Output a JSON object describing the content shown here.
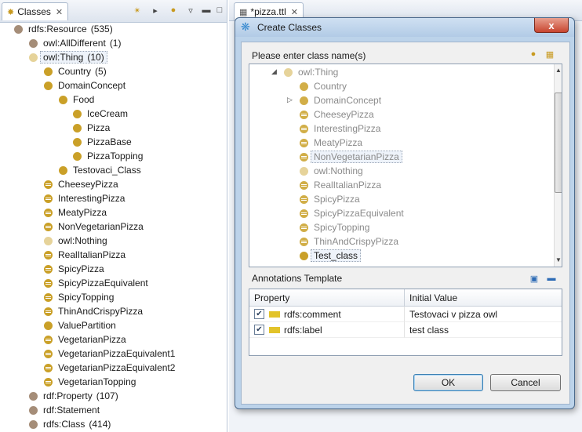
{
  "left_view": {
    "tab_label": "Classes",
    "toolbar_icons": [
      "add-subclass-icon",
      "add-sibling-icon",
      "delete-class-icon",
      "view-menu-icon",
      "minimize-icon",
      "maximize-icon"
    ],
    "tree": [
      {
        "label": "rdfs:Resource",
        "count": "(535)",
        "icon": "resource",
        "depth": 0
      },
      {
        "label": "owl:AllDifferent",
        "count": "(1)",
        "icon": "resource",
        "depth": 1
      },
      {
        "label": "owl:Thing",
        "count": "(10)",
        "icon": "pale",
        "depth": 1,
        "selected": true
      },
      {
        "label": "Country",
        "count": "(5)",
        "icon": "gold",
        "depth": 2
      },
      {
        "label": "DomainConcept",
        "count": "",
        "icon": "gold",
        "depth": 2
      },
      {
        "label": "Food",
        "count": "",
        "icon": "gold",
        "depth": 3
      },
      {
        "label": "IceCream",
        "count": "",
        "icon": "gold",
        "depth": 4
      },
      {
        "label": "Pizza",
        "count": "",
        "icon": "gold",
        "depth": 4
      },
      {
        "label": "PizzaBase",
        "count": "",
        "icon": "gold",
        "depth": 4
      },
      {
        "label": "PizzaTopping",
        "count": "",
        "icon": "gold",
        "depth": 4
      },
      {
        "label": "Testovaci_Class",
        "count": "",
        "icon": "gold",
        "depth": 3
      },
      {
        "label": "CheeseyPizza",
        "count": "",
        "icon": "defined",
        "depth": 2
      },
      {
        "label": "InterestingPizza",
        "count": "",
        "icon": "defined",
        "depth": 2
      },
      {
        "label": "MeatyPizza",
        "count": "",
        "icon": "defined",
        "depth": 2
      },
      {
        "label": "NonVegetarianPizza",
        "count": "",
        "icon": "defined",
        "depth": 2
      },
      {
        "label": "owl:Nothing",
        "count": "",
        "icon": "pale",
        "depth": 2
      },
      {
        "label": "RealItalianPizza",
        "count": "",
        "icon": "defined",
        "depth": 2
      },
      {
        "label": "SpicyPizza",
        "count": "",
        "icon": "defined",
        "depth": 2
      },
      {
        "label": "SpicyPizzaEquivalent",
        "count": "",
        "icon": "defined",
        "depth": 2
      },
      {
        "label": "SpicyTopping",
        "count": "",
        "icon": "defined",
        "depth": 2
      },
      {
        "label": "ThinAndCrispyPizza",
        "count": "",
        "icon": "defined",
        "depth": 2
      },
      {
        "label": "ValuePartition",
        "count": "",
        "icon": "gold",
        "depth": 2
      },
      {
        "label": "VegetarianPizza",
        "count": "",
        "icon": "defined",
        "depth": 2
      },
      {
        "label": "VegetarianPizzaEquivalent1",
        "count": "",
        "icon": "defined",
        "depth": 2
      },
      {
        "label": "VegetarianPizzaEquivalent2",
        "count": "",
        "icon": "defined",
        "depth": 2
      },
      {
        "label": "VegetarianTopping",
        "count": "",
        "icon": "defined",
        "depth": 2
      },
      {
        "label": "rdf:Property",
        "count": "(107)",
        "icon": "resource",
        "depth": 1
      },
      {
        "label": "rdf:Statement",
        "count": "",
        "icon": "resource",
        "depth": 1
      },
      {
        "label": "rdfs:Class",
        "count": "(414)",
        "icon": "resource",
        "depth": 1
      }
    ]
  },
  "editor": {
    "tab_label": "*pizza.ttl"
  },
  "dialog": {
    "title": "Create Classes",
    "close_label": "x",
    "class_name_label": "Please enter class name(s)",
    "tree": [
      {
        "label": "owl:Thing",
        "icon": "pale",
        "depth": 0,
        "twisty": "expanded"
      },
      {
        "label": "Country",
        "icon": "gold",
        "depth": 1
      },
      {
        "label": "DomainConcept",
        "icon": "gold",
        "depth": 1,
        "twisty": "collapsed"
      },
      {
        "label": "CheeseyPizza",
        "icon": "defined",
        "depth": 1
      },
      {
        "label": "InterestingPizza",
        "icon": "defined",
        "depth": 1
      },
      {
        "label": "MeatyPizza",
        "icon": "defined",
        "depth": 1
      },
      {
        "label": "NonVegetarianPizza",
        "icon": "defined",
        "depth": 1,
        "boxed": true
      },
      {
        "label": "owl:Nothing",
        "icon": "pale",
        "depth": 1
      },
      {
        "label": "RealItalianPizza",
        "icon": "defined",
        "depth": 1
      },
      {
        "label": "SpicyPizza",
        "icon": "defined",
        "depth": 1
      },
      {
        "label": "SpicyPizzaEquivalent",
        "icon": "defined",
        "depth": 1
      },
      {
        "label": "SpicyTopping",
        "icon": "defined",
        "depth": 1
      },
      {
        "label": "ThinAndCrispyPizza",
        "icon": "defined",
        "depth": 1
      },
      {
        "label": "Test_class",
        "icon": "gold",
        "depth": 1,
        "selected": true
      }
    ],
    "annotations_label": "Annotations Template",
    "annotations_columns": [
      "Property",
      "Initial Value"
    ],
    "annotations_rows": [
      {
        "checked": true,
        "property": "rdfs:comment",
        "value": "Testovaci v pizza owl"
      },
      {
        "checked": true,
        "property": "rdfs:label",
        "value": "test class"
      }
    ],
    "ok_label": "OK",
    "cancel_label": "Cancel"
  },
  "colors": {
    "resource_icon": "#a58d78",
    "class_icon": "#caa028",
    "thing_icon": "#e6d39a",
    "dialog_frame": "#bcd3ea"
  }
}
